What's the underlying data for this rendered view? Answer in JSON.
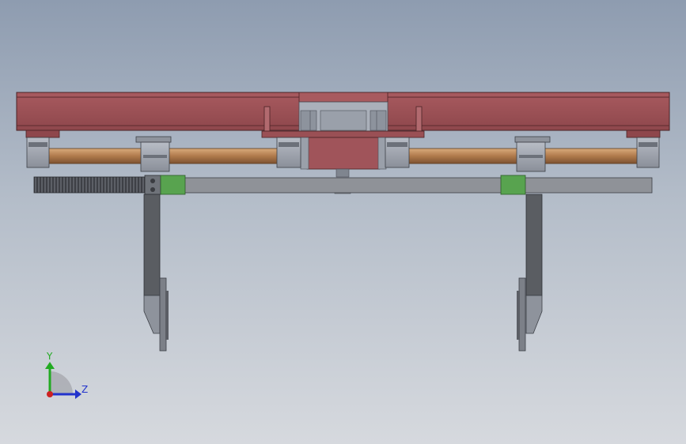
{
  "viewport": {
    "background_top": "#8e9cb0",
    "background_bottom": "#d6d9de"
  },
  "colors": {
    "beam": "#9a5055",
    "beam_dark": "#6e3236",
    "shaft": "#b58457",
    "rack": "#4a4c52",
    "bar": "#8f9298",
    "collar": "#58a34f",
    "bracket": "#9ea3ac",
    "arm": "#5a5d62",
    "axis_x": "#cc2222",
    "axis_y": "#22aa22",
    "axis_z": "#2233cc"
  },
  "triad": {
    "y_label": "Y",
    "z_label": "Z"
  }
}
